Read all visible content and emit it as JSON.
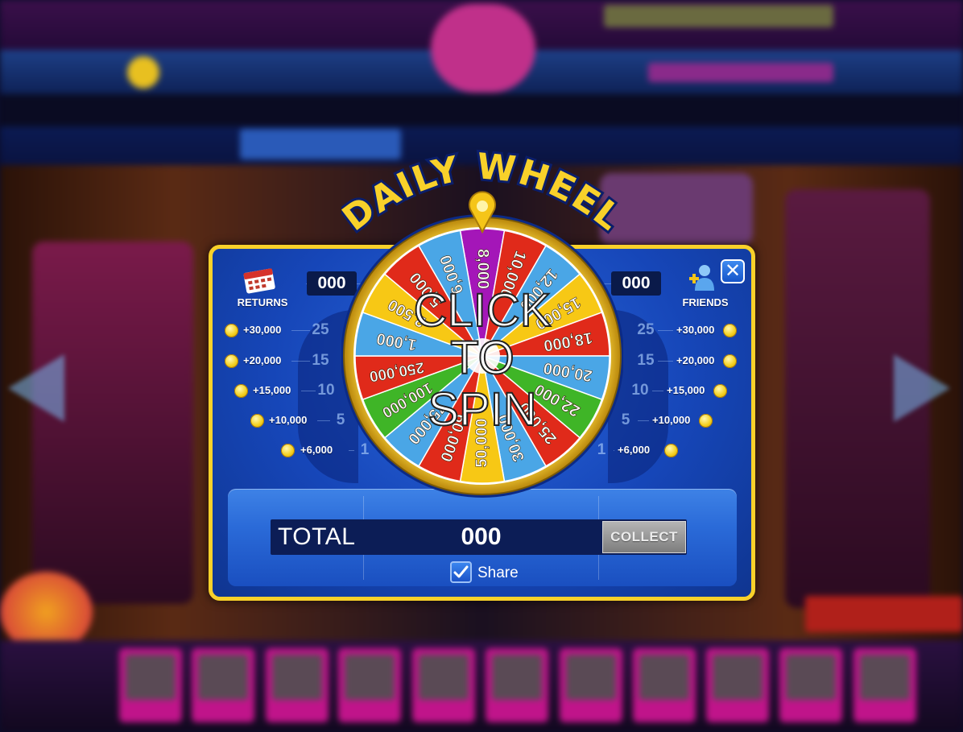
{
  "dialog": {
    "title": "DAILY WHEEL",
    "close_glyph": "✕",
    "spin_lines": [
      "CLICK",
      "TO",
      "SPIN"
    ],
    "returns": {
      "label": "RETURNS",
      "count": "000",
      "icon": "calendar-icon"
    },
    "friends": {
      "label": "FRIENDS",
      "count": "000",
      "icon": "add-friend-icon"
    },
    "left_rewards": [
      {
        "bonus": "+30,000",
        "tier": "25"
      },
      {
        "bonus": "+20,000",
        "tier": "15"
      },
      {
        "bonus": "+15,000",
        "tier": "10"
      },
      {
        "bonus": "+10,000",
        "tier": "5"
      },
      {
        "bonus": "+6,000",
        "tier": "1"
      }
    ],
    "right_rewards": [
      {
        "bonus": "+30,000",
        "tier": "25"
      },
      {
        "bonus": "+20,000",
        "tier": "15"
      },
      {
        "bonus": "+15,000",
        "tier": "10"
      },
      {
        "bonus": "+10,000",
        "tier": "5"
      },
      {
        "bonus": "+6,000",
        "tier": "1"
      }
    ],
    "total_label": "TOTAL",
    "total_value": "000",
    "collect_label": "COLLECT",
    "share_label": "Share",
    "share_checked": true
  },
  "wheel": {
    "segments": [
      {
        "label": "8,000",
        "color": "#a416b8"
      },
      {
        "label": "10,000",
        "color": "#e02a1a"
      },
      {
        "label": "12,000",
        "color": "#4aa6e6"
      },
      {
        "label": "15,000",
        "color": "#f7c815"
      },
      {
        "label": "18,000",
        "color": "#e02a1a"
      },
      {
        "label": "20,000",
        "color": "#4aa6e6"
      },
      {
        "label": "22,000",
        "color": "#3fb527"
      },
      {
        "label": "25,000",
        "color": "#e02a1a"
      },
      {
        "label": "30,000",
        "color": "#4aa6e6"
      },
      {
        "label": "50,000",
        "color": "#f7c815"
      },
      {
        "label": "60,000",
        "color": "#e02a1a"
      },
      {
        "label": "75,000",
        "color": "#4aa6e6"
      },
      {
        "label": "100,000",
        "color": "#3fb527"
      },
      {
        "label": "250,000",
        "color": "#e02a1a"
      },
      {
        "label": "1,000",
        "color": "#4aa6e6"
      },
      {
        "label": "2,500",
        "color": "#f7c815"
      },
      {
        "label": "5,000",
        "color": "#e02a1a"
      },
      {
        "label": "6,000",
        "color": "#4aa6e6"
      }
    ]
  },
  "colors": {
    "frame": "#f8d12a",
    "dialog_blue": "#1646b8",
    "pointer": "#f5c518"
  }
}
